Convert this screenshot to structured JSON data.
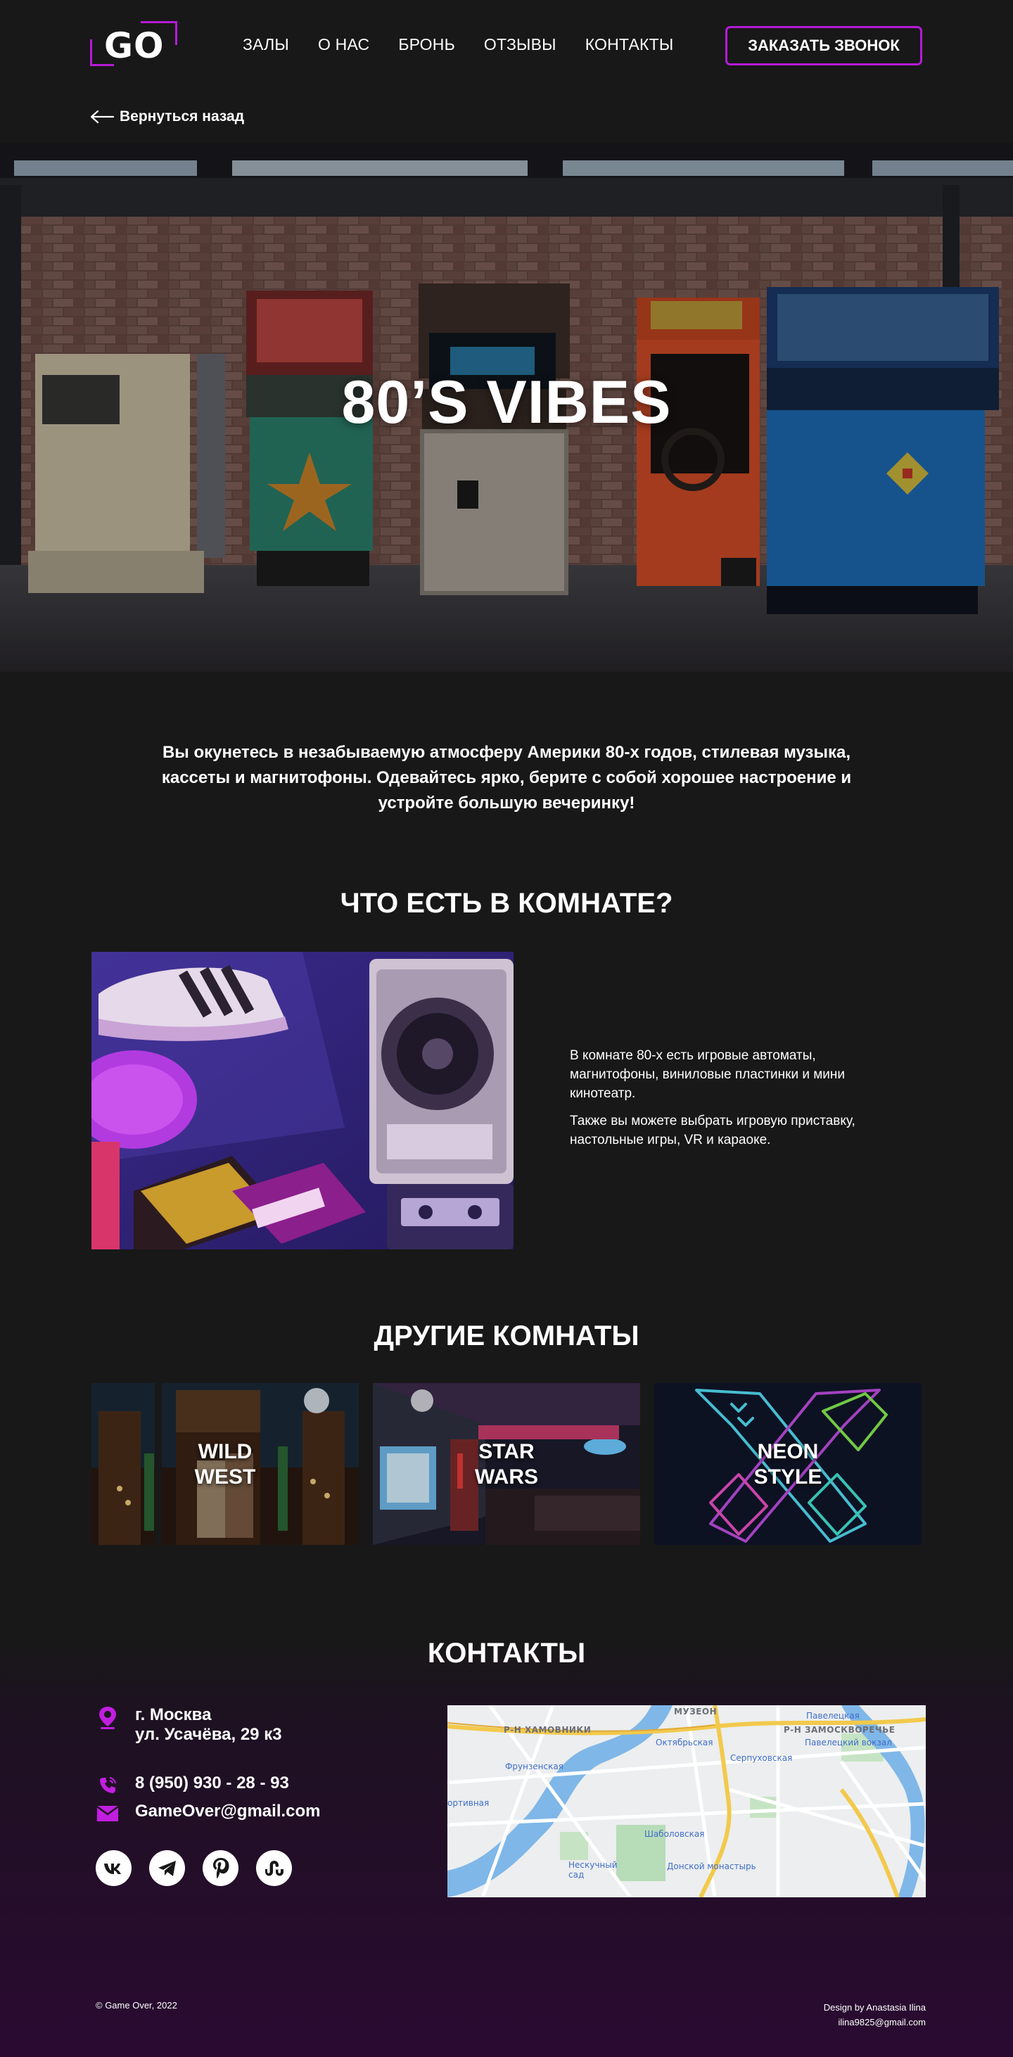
{
  "header": {
    "logo_text": "GO",
    "nav": [
      "ЗАЛЫ",
      "О НАС",
      "БРОНЬ",
      "ОТЗЫВЫ",
      "КОНТАКТЫ"
    ],
    "call_button": "ЗАКАЗАТЬ ЗВОНОК",
    "back_link": "Вернуться назад",
    "accent_color": "#b51bd6"
  },
  "hero": {
    "title": "80’S VIBES"
  },
  "intro": "Вы окунетесь в незабываемую атмосферу Америки 80-х годов, стилевая музыка, кассеты и магнитофоны. Одевайтесь ярко, берите с собой хорошее настроение и устройте большую вечеринку!",
  "room": {
    "title": "ЧТО ЕСТЬ В КОМНАТЕ?",
    "paragraphs": [
      "В комнате 80-х есть игровые автоматы, магнитофоны, виниловые пластинки и мини кинотеатр.",
      "Также вы можете выбрать игровую приставку, настольные игры, VR и караоке."
    ]
  },
  "other_rooms": {
    "title": "ДРУГИЕ КОМНАТЫ",
    "cards": [
      {
        "label": "WILD\nWEST"
      },
      {
        "label": "STAR\nWARS"
      },
      {
        "label": "NEON\nSTYLE"
      }
    ]
  },
  "contacts": {
    "title": "КОНТАКТЫ",
    "city": "г. Москва",
    "street": "ул. Усачёва, 29 к3",
    "phone": "8 (950) 930 - 28 - 93",
    "email": "GameOver@gmail.com",
    "socials": [
      "vk-icon",
      "telegram-icon",
      "pinterest-icon",
      "stumbleupon-icon"
    ],
    "map_labels": {
      "khamovniki": "Р-Н ХАМОВНИКИ",
      "zamoskvorechye": "Р-Н ЗАМОСКВОРЕЧЬЕ",
      "museon": "МУЗЕОН",
      "paveletskaya": "Павелецкая",
      "oktyabrskaya": "Октябрьская",
      "serpukhovskaya": "Серпуховская",
      "paveletsky_vokzal": "Павелецкий вокзал",
      "frunzenskaya": "Фрунзенская",
      "sportivnaya": "ортивная",
      "shabolovskaya": "Шаболовская",
      "neskuchny": "Нескучный\nсад",
      "donskoy": "Донской монастырь"
    }
  },
  "footer": {
    "copyright": "© Game Over, 2022",
    "design_by": "Design by Anastasia Ilina",
    "design_email": "ilina9825@gmail.com"
  }
}
